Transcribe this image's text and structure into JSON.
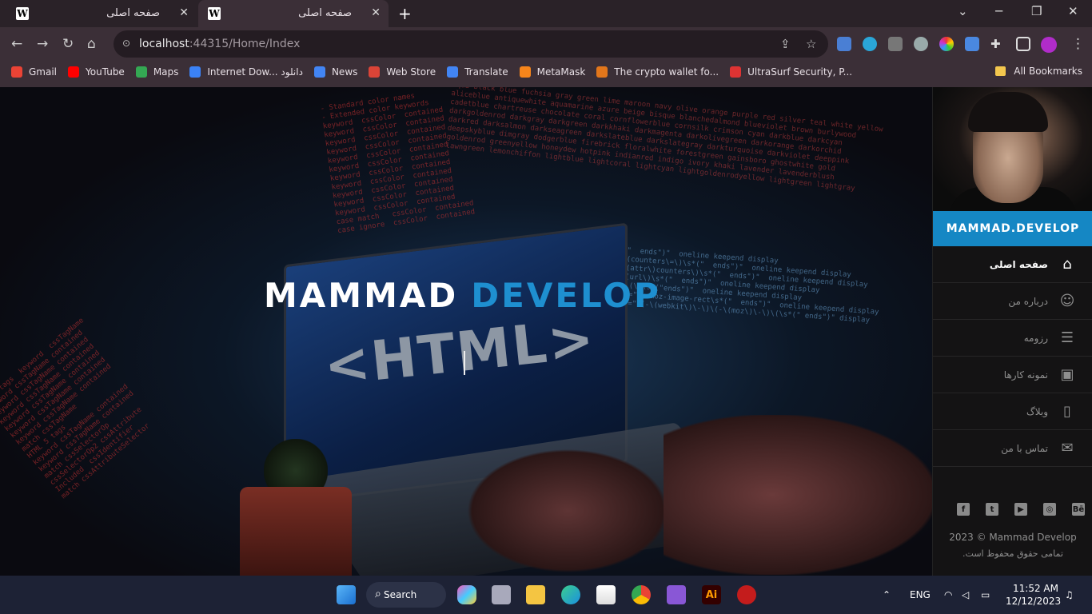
{
  "browser": {
    "tabs": [
      {
        "favicon": "W",
        "title": "صفحه اصلی",
        "close": "✕"
      },
      {
        "favicon": "W",
        "title": "صفحه اصلی",
        "close": "✕"
      }
    ],
    "new_tab": "+",
    "url_host": "localhost",
    "url_rest": ":44315/Home/Index",
    "bookmarks": [
      {
        "label": "Gmail",
        "color": "#ea4335"
      },
      {
        "label": "YouTube",
        "color": "#ff0000"
      },
      {
        "label": "Maps",
        "color": "#34a853"
      },
      {
        "label": "Internet Dow... دانلود",
        "color": "#3b82f6"
      },
      {
        "label": "News",
        "color": "#4285f4"
      },
      {
        "label": "Web Store",
        "color": "#db4437"
      },
      {
        "label": "Translate",
        "color": "#4285f4"
      },
      {
        "label": "MetaMask",
        "color": "#f6851b"
      },
      {
        "label": "The crypto wallet fo...",
        "color": "#e2761b"
      },
      {
        "label": "UltraSurf Security, P...",
        "color": "#d33"
      }
    ],
    "all_bookmarks": "All Bookmarks"
  },
  "hero": {
    "title_word1": "MAMMAD",
    "title_word2": "DEVELOP",
    "screen_text": "<HTML>"
  },
  "sidebar": {
    "brand": "MAMMAD.DEVELOP",
    "menu": [
      {
        "label": "صفحه اصلی",
        "icon": "home-icon",
        "active": true
      },
      {
        "label": "درباره من",
        "icon": "user-icon",
        "active": false
      },
      {
        "label": "رزومه",
        "icon": "resume-icon",
        "active": false
      },
      {
        "label": "نمونه کارها",
        "icon": "briefcase-icon",
        "active": false
      },
      {
        "label": "وبلاگ",
        "icon": "book-icon",
        "active": false
      },
      {
        "label": "تماس با من",
        "icon": "mail-icon",
        "active": false
      }
    ],
    "social": [
      {
        "icon": "facebook-icon",
        "glyph": "f"
      },
      {
        "icon": "twitter-icon",
        "glyph": "t"
      },
      {
        "icon": "youtube-icon",
        "glyph": "▶"
      },
      {
        "icon": "dribbble-icon",
        "glyph": "◎"
      },
      {
        "icon": "behance-icon",
        "glyph": "Bē"
      }
    ],
    "copyright": "2023 © Mammad Develop",
    "rights": "تمامی حقوق محفوظ است."
  },
  "taskbar": {
    "search": "Search",
    "lang": "ENG",
    "time": "11:52 AM",
    "date": "12/12/2023"
  },
  "colors": {
    "accent": "#1587c4",
    "title_blue": "#1e8fd0",
    "sidebar_bg": "#141314"
  }
}
